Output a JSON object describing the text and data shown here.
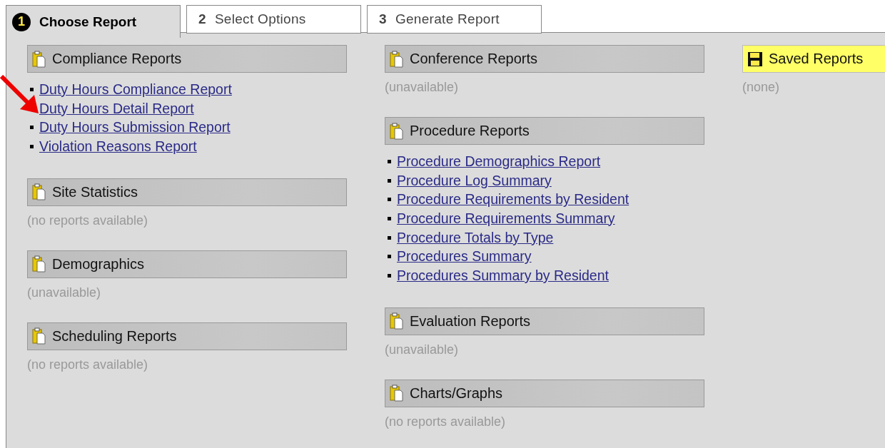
{
  "tabs": [
    {
      "number": "1",
      "label": "Choose Report",
      "selected": true
    },
    {
      "number": "2",
      "label": "Select Options",
      "selected": false
    },
    {
      "number": "3",
      "label": "Generate Report",
      "selected": false
    }
  ],
  "columns": [
    {
      "sections": [
        {
          "kind": "reports",
          "title": "Compliance Reports",
          "links": [
            "Duty Hours Compliance Report",
            "Duty Hours Detail Report",
            "Duty Hours Submission Report",
            "Violation Reasons Report"
          ]
        },
        {
          "kind": "reports",
          "title": "Site Statistics",
          "note": "(no reports available)"
        },
        {
          "kind": "reports",
          "title": "Demographics",
          "note": "(unavailable)"
        },
        {
          "kind": "reports",
          "title": "Scheduling Reports",
          "note": "(no reports available)"
        }
      ]
    },
    {
      "sections": [
        {
          "kind": "reports",
          "title": "Conference Reports",
          "note": "(unavailable)"
        },
        {
          "kind": "reports",
          "title": "Procedure Reports",
          "links": [
            "Procedure Demographics Report",
            "Procedure Log Summary",
            "Procedure Requirements by Resident",
            "Procedure Requirements Summary",
            "Procedure Totals by Type",
            "Procedures Summary",
            "Procedures Summary by Resident"
          ]
        },
        {
          "kind": "reports",
          "title": "Evaluation Reports",
          "note": "(unavailable)"
        },
        {
          "kind": "reports",
          "title": "Charts/Graphs",
          "note": "(no reports available)"
        }
      ]
    },
    {
      "sections": [
        {
          "kind": "saved",
          "title": "Saved Reports",
          "note": "(none)"
        }
      ]
    }
  ]
}
